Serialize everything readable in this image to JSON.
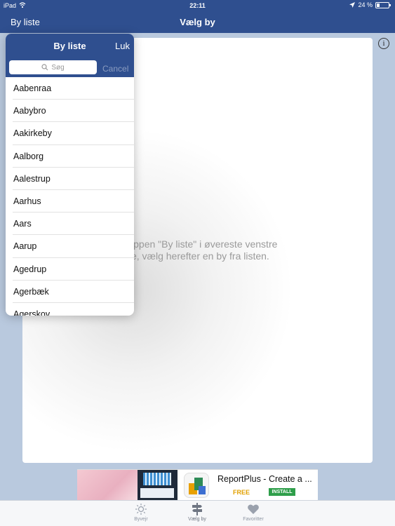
{
  "status_bar": {
    "carrier": "iPad",
    "time": "22:11",
    "battery_text": "24 %",
    "battery_level": 0.24
  },
  "nav": {
    "back_label": "By liste",
    "title": "Vælg by"
  },
  "main": {
    "hint_text": "knappen \"By liste\" i øvereste venstre\nne, vælg herefter en by fra listen.",
    "info_icon": "info-icon"
  },
  "popover": {
    "title": "By liste",
    "close_label": "Luk",
    "search_placeholder": "Søg",
    "cancel_label": "Cancel",
    "cities": [
      "Aabenraa",
      "Aabybro",
      "Aakirkeby",
      "Aalborg",
      "Aalestrup",
      "Aarhus",
      "Aars",
      "Aarup",
      "Agedrup",
      "Agerbæk",
      "Agerskov"
    ]
  },
  "ad": {
    "title": "ReportPlus - Create a ...",
    "price": "FREE",
    "install_label": "INSTALL"
  },
  "tabbar": {
    "items": [
      {
        "label": "Byvejr",
        "icon": "sun-icon"
      },
      {
        "label": "Vælg by",
        "icon": "signpost-icon"
      },
      {
        "label": "Favoritter",
        "icon": "heart-icon"
      }
    ]
  }
}
